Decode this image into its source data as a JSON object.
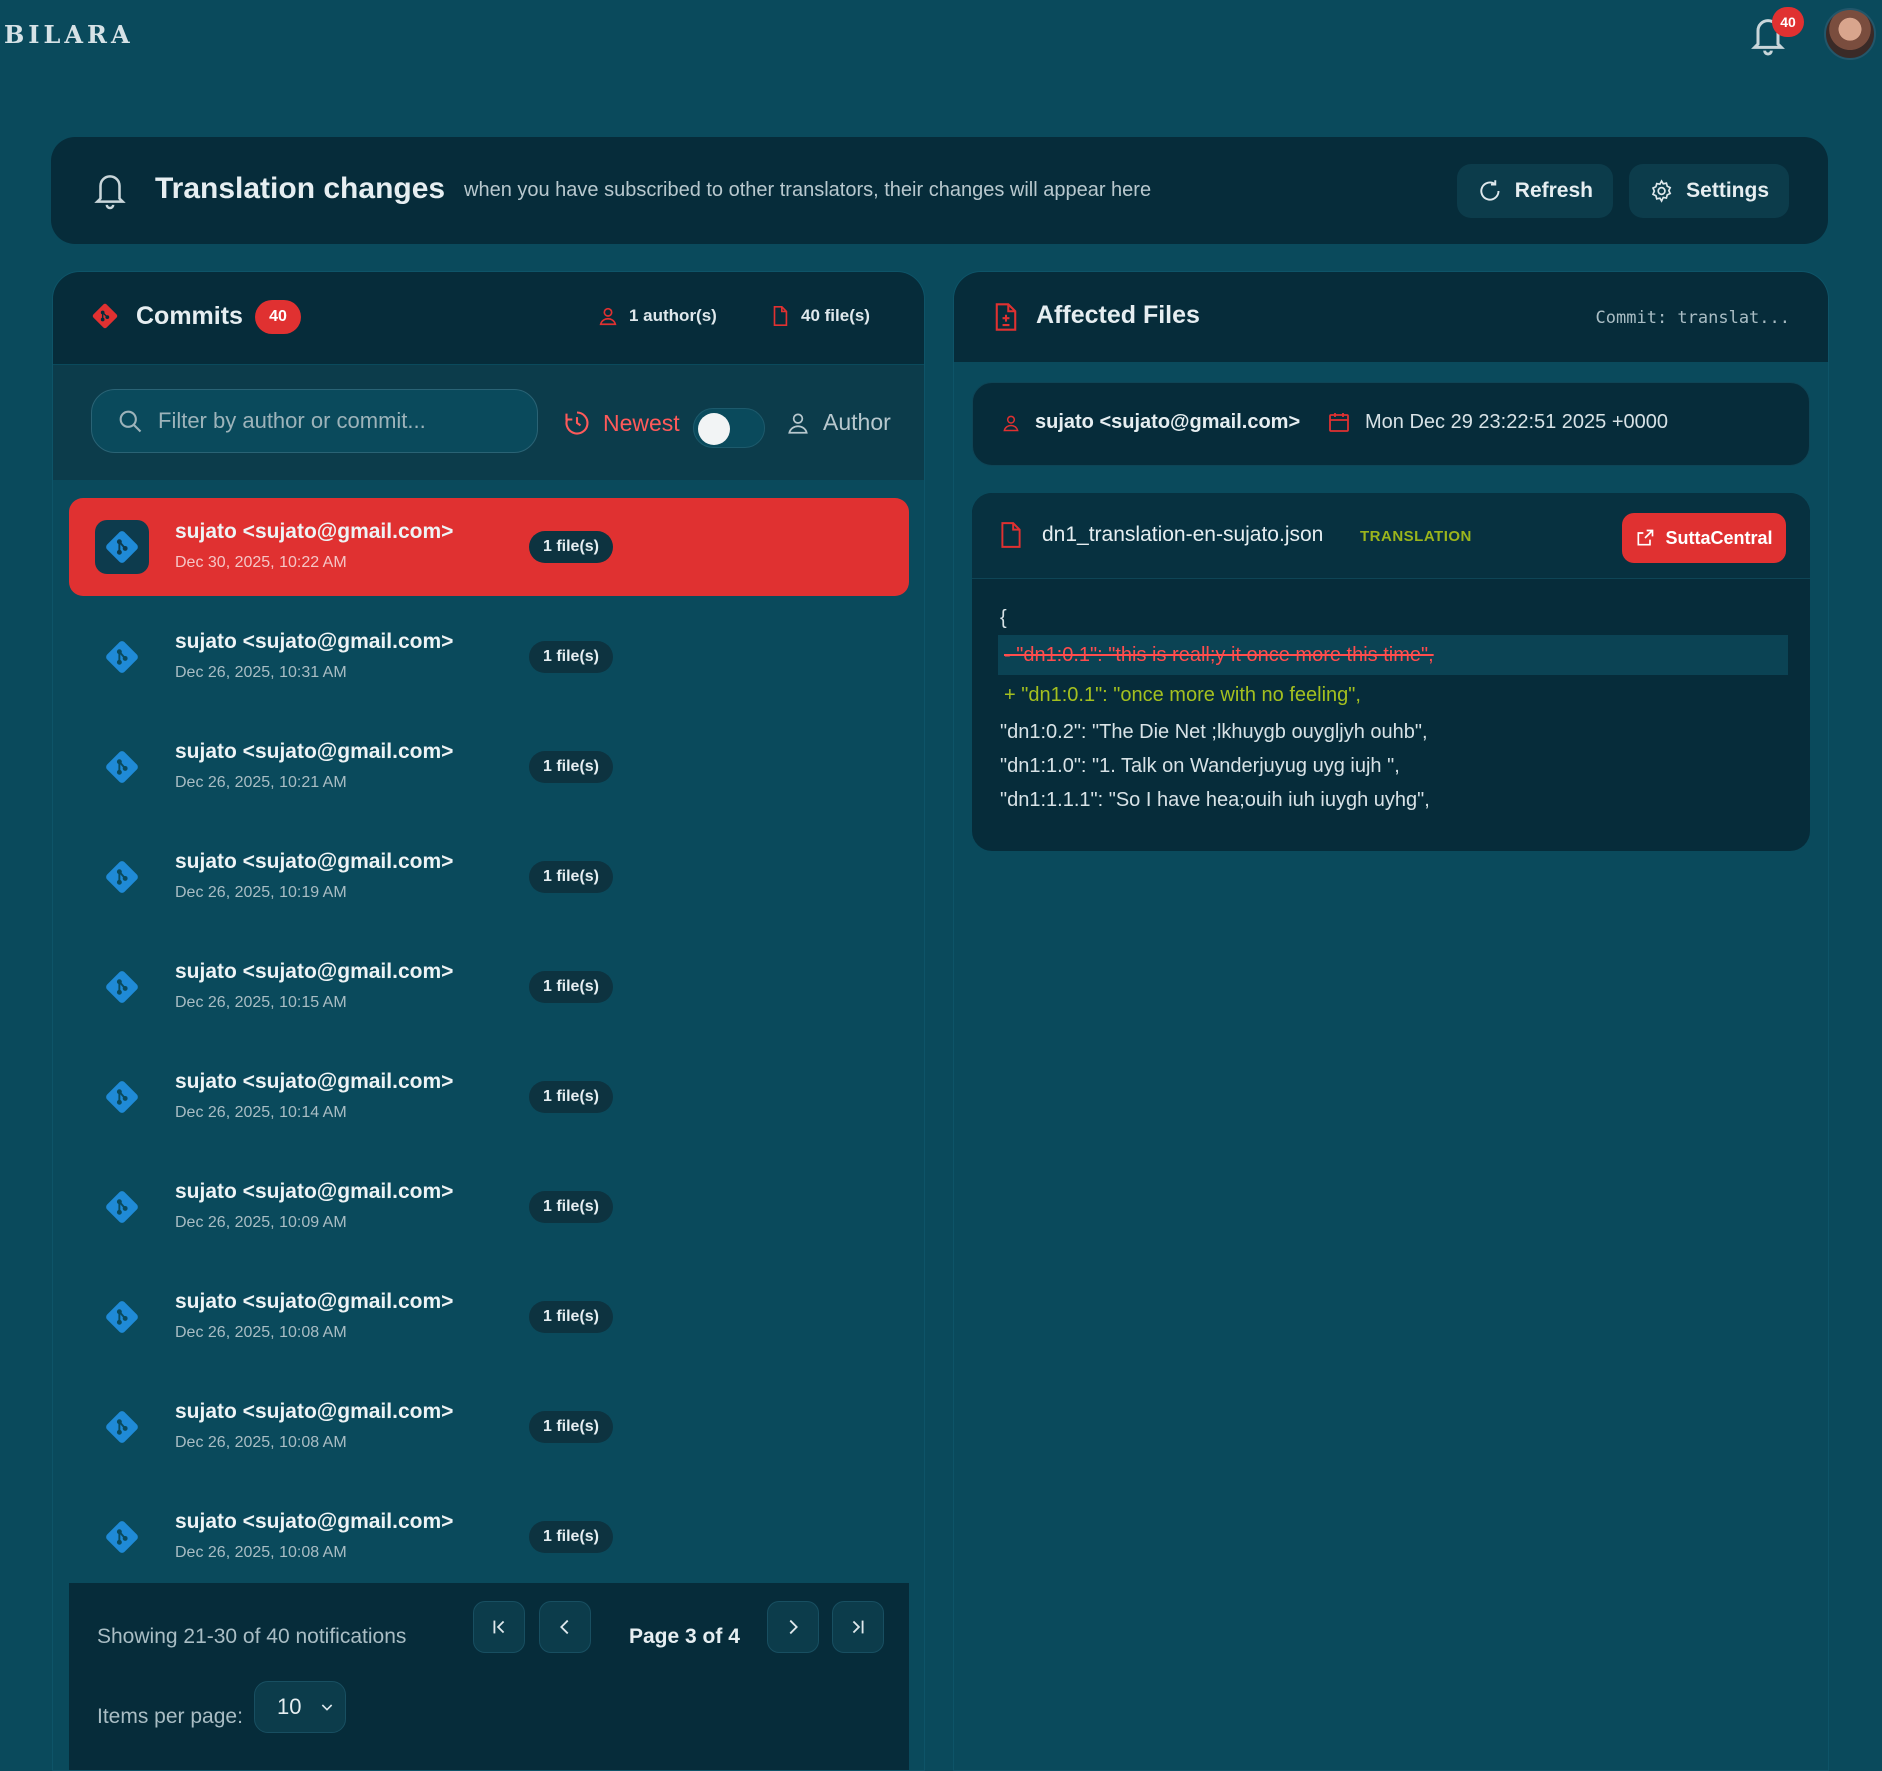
{
  "app": {
    "logo": "BILARA",
    "notification_count": "40"
  },
  "header": {
    "title": "Translation changes",
    "subtitle": "when you have subscribed to other translators, their changes will appear here",
    "refresh_label": "Refresh",
    "settings_label": "Settings"
  },
  "commits": {
    "title": "Commits",
    "count": "40",
    "authors_stat": "1 author(s)",
    "files_stat": "40 file(s)",
    "filter_placeholder": "Filter by author or commit...",
    "sort_newest": "Newest",
    "sort_author": "Author",
    "items": [
      {
        "author": "sujato <sujato@gmail.com>",
        "date": "Dec 30, 2025, 10:22 AM",
        "files": "1 file(s)"
      },
      {
        "author": "sujato <sujato@gmail.com>",
        "date": "Dec 26, 2025, 10:31 AM",
        "files": "1 file(s)"
      },
      {
        "author": "sujato <sujato@gmail.com>",
        "date": "Dec 26, 2025, 10:21 AM",
        "files": "1 file(s)"
      },
      {
        "author": "sujato <sujato@gmail.com>",
        "date": "Dec 26, 2025, 10:19 AM",
        "files": "1 file(s)"
      },
      {
        "author": "sujato <sujato@gmail.com>",
        "date": "Dec 26, 2025, 10:15 AM",
        "files": "1 file(s)"
      },
      {
        "author": "sujato <sujato@gmail.com>",
        "date": "Dec 26, 2025, 10:14 AM",
        "files": "1 file(s)"
      },
      {
        "author": "sujato <sujato@gmail.com>",
        "date": "Dec 26, 2025, 10:09 AM",
        "files": "1 file(s)"
      },
      {
        "author": "sujato <sujato@gmail.com>",
        "date": "Dec 26, 2025, 10:08 AM",
        "files": "1 file(s)"
      },
      {
        "author": "sujato <sujato@gmail.com>",
        "date": "Dec 26, 2025, 10:08 AM",
        "files": "1 file(s)"
      },
      {
        "author": "sujato <sujato@gmail.com>",
        "date": "Dec 26, 2025, 10:08 AM",
        "files": "1 file(s)"
      }
    ],
    "pager": {
      "showing": "Showing 21-30 of 40 notifications",
      "page": "Page 3 of 4",
      "items_per_page_label": "Items per page:",
      "items_per_page": "10"
    }
  },
  "affected": {
    "title": "Affected Files",
    "commit_ref": "Commit: translat...",
    "author": "sujato <sujato@gmail.com>",
    "date": "Mon Dec 29 23:22:51 2025 +0000",
    "file": {
      "name": "dn1_translation-en-sujato.json",
      "type": "TRANSLATION",
      "link_label": "SuttaCentral"
    },
    "diff": {
      "open": "{",
      "removed": "- \"dn1:0.1\": \"this is reall;y it once more this time\",",
      "added": "+ \"dn1:0.1\": \"once more with no feeling\",",
      "lines": [
        "\"dn1:0.2\": \"The Die Net ;lkhuygb ouygljyh ouhb\",",
        "\"dn1:1.0\": \"1. Talk on Wanderjuyug uyg iujh \",",
        "\"dn1:1.1.1\": \"So I have hea;ouih iuh iuygh uyhg\","
      ]
    }
  },
  "colors": {
    "background": "#0a4a5c",
    "panel_dark": "#062c3a",
    "accent_red": "#e03131",
    "git_blue": "#1f8ad6",
    "added_green": "#a4c01f"
  }
}
